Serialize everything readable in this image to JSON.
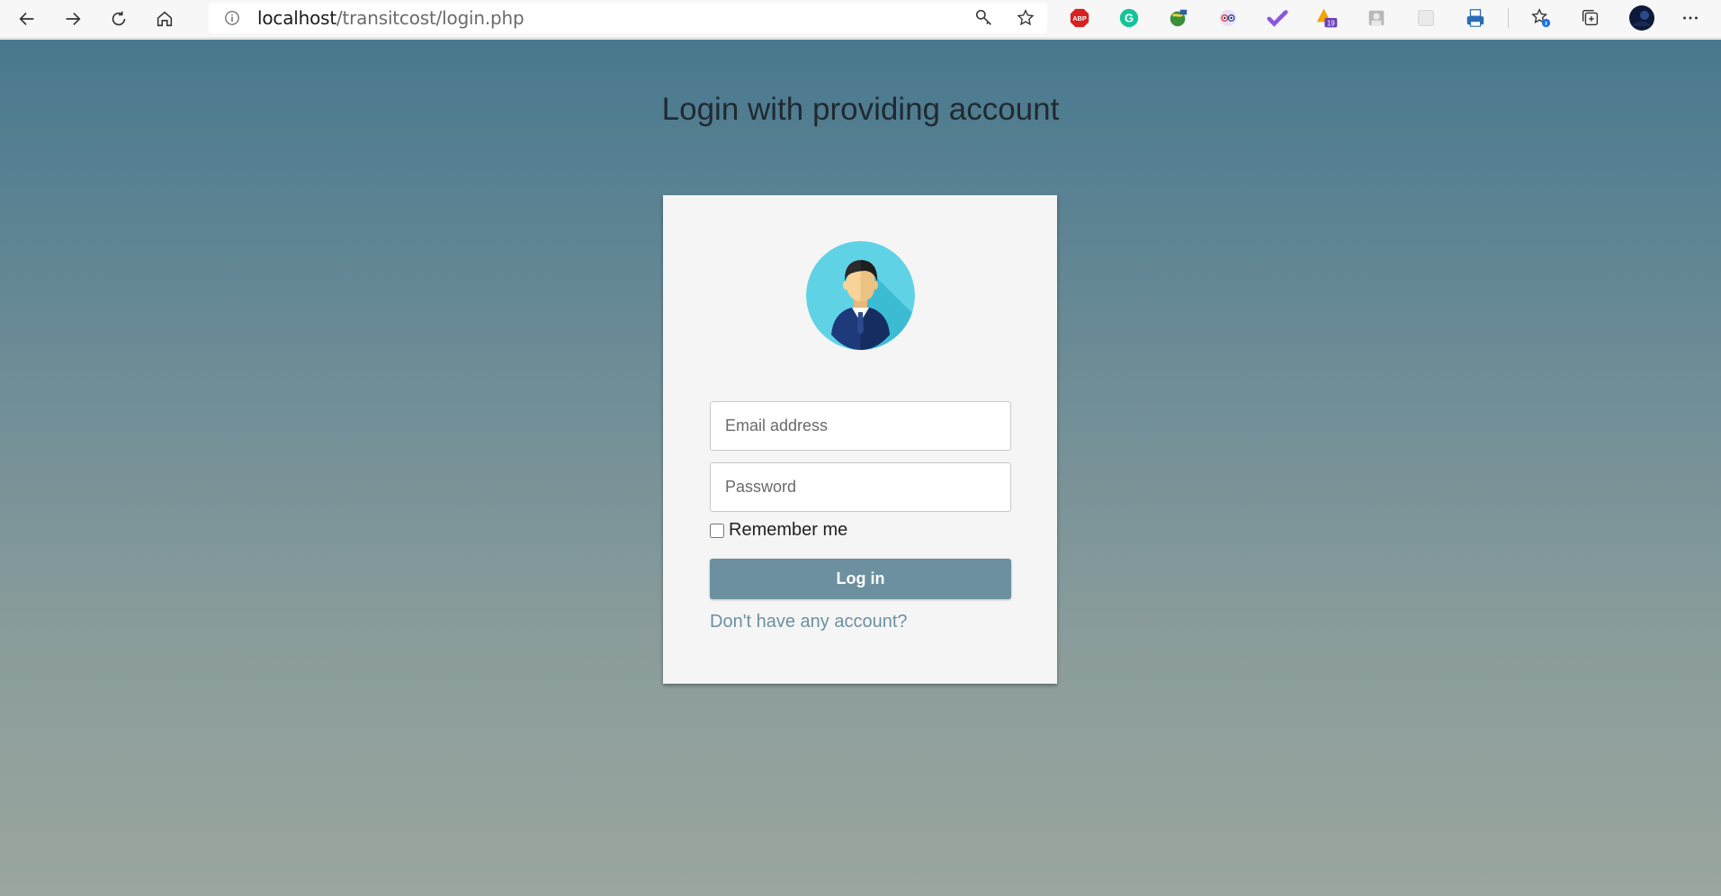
{
  "browser": {
    "url_host": "localhost",
    "url_path": "/transitcost/login.php",
    "extensions": [
      {
        "name": "abp-icon",
        "label": "ABP"
      },
      {
        "name": "grammarly-icon",
        "label": "G"
      },
      {
        "name": "globe-extension-icon"
      },
      {
        "name": "eyes-extension-icon"
      },
      {
        "name": "checkmark-extension-icon"
      },
      {
        "name": "badge-extension-icon",
        "badge": "19"
      },
      {
        "name": "portrait-extension-icon"
      },
      {
        "name": "blank-extension-icon"
      },
      {
        "name": "printer-extension-icon"
      }
    ]
  },
  "page": {
    "title": "Login with providing account"
  },
  "form": {
    "email_placeholder": "Email address",
    "password_placeholder": "Password",
    "remember_label": "Remember me",
    "login_label": "Log in",
    "signup_link": "Don't have any account?"
  },
  "colors": {
    "button": "#6c909f",
    "avatar_bg": "#5fd3e5"
  }
}
